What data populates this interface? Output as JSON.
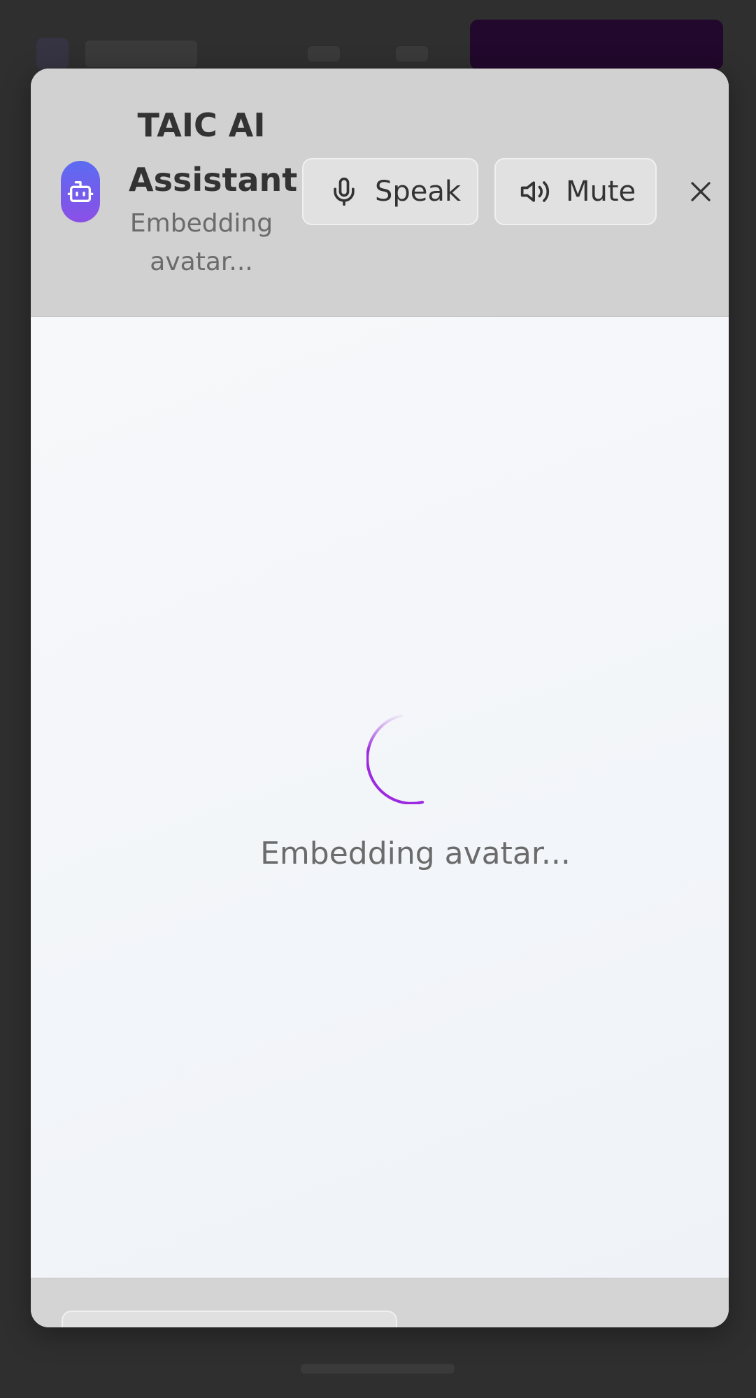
{
  "header": {
    "title": "TAIC AI Assistant",
    "status": "Embedding avatar...",
    "avatar_icon": "bot-icon",
    "speak_label": "Speak",
    "mute_label": "Mute"
  },
  "main": {
    "loading_text": "Embedding avatar..."
  },
  "colors": {
    "header_bg": "#d1d1d1",
    "accent_gradient_start": "#5b6cf2",
    "accent_gradient_end": "#8b4fe6",
    "spinner": "#9b2ae0"
  }
}
